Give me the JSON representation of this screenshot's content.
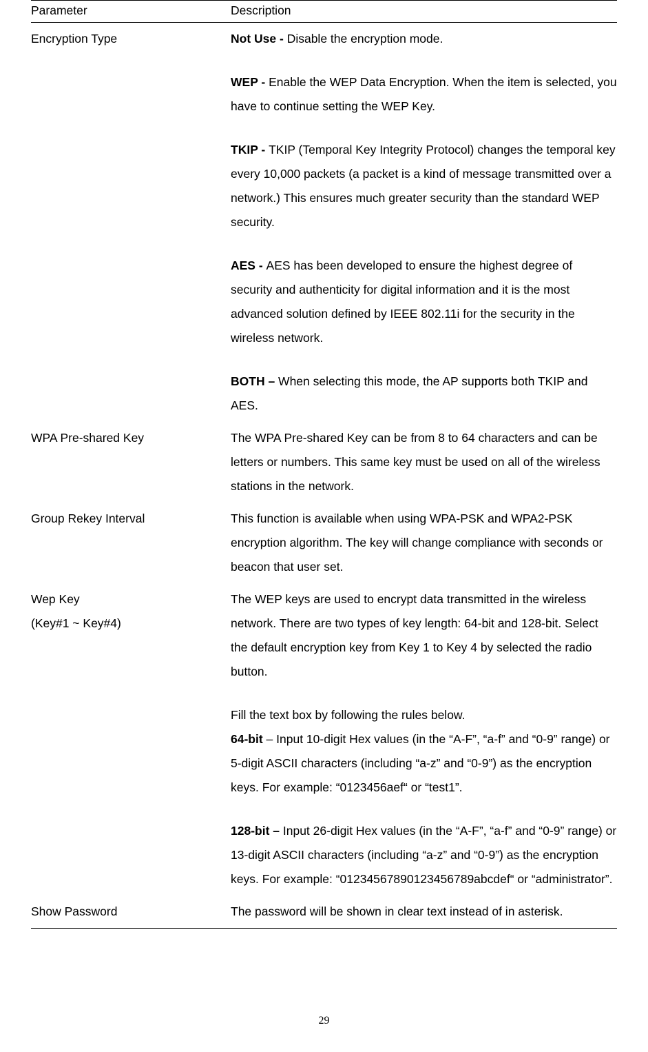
{
  "table": {
    "headers": {
      "param": "Parameter",
      "desc": "Description"
    },
    "rows": [
      {
        "param": "Encryption Type",
        "blocks": [
          {
            "bold": "Not Use - ",
            "text": "Disable the encryption mode."
          },
          {
            "bold": "WEP - ",
            "text": "Enable the WEP Data Encryption. When the item is selected, you have to continue setting the WEP Key."
          },
          {
            "bold": "TKIP - ",
            "text": "TKIP (Temporal Key Integrity Protocol) changes the temporal key every 10,000 packets (a packet is a kind of message transmitted over a network.) This ensures much greater security than the standard WEP security."
          },
          {
            "bold": "AES - ",
            "text": "AES has been developed to ensure the highest degree of security and authenticity for digital information and it is the most advanced solution defined by IEEE 802.11i for the security in the wireless network."
          },
          {
            "bold": "BOTH – ",
            "text": "When selecting this mode, the AP supports both TKIP and AES."
          }
        ]
      },
      {
        "param": "WPA Pre-shared Key",
        "blocks": [
          {
            "bold": "",
            "text": "The WPA Pre-shared Key can be from 8 to 64 characters and can be letters or numbers. This same key must be used on all of the wireless stations in the network."
          }
        ]
      },
      {
        "param": "Group Rekey Interval",
        "blocks": [
          {
            "bold": "",
            "text": "This function is available when using WPA-PSK and WPA2-PSK encryption algorithm. The key will change compliance with seconds or beacon that user set."
          }
        ]
      },
      {
        "param": "Wep Key",
        "param_line2": "(Key#1 ~ Key#4)",
        "blocks": [
          {
            "bold": "",
            "text": "The WEP keys are used to encrypt data transmitted in the wireless network. There are two types of key length: 64-bit and 128-bit. Select the default encryption key from Key 1 to Key 4 by selected the radio button."
          },
          {
            "pre": "Fill the text box by following the rules below.",
            "bold": "64-bit",
            "text": " – Input 10-digit Hex values (in the “A-F”, “a-f” and “0-9” range) or 5-digit ASCII characters (including “a-z” and “0-9”) as the encryption keys. For example: “0123456aef“ or “test1”."
          },
          {
            "bold": "128-bit – ",
            "text": "Input 26-digit Hex values (in the “A-F”, “a-f” and “0-9” range) or 13-digit ASCII characters (including “a-z” and “0-9”) as the encryption keys. For example: “01234567890123456789abcdef“ or “administrator”."
          }
        ]
      },
      {
        "param": "Show Password",
        "blocks": [
          {
            "bold": "",
            "text": "The password will be shown in clear text instead of in asterisk."
          }
        ]
      }
    ]
  },
  "page_number": "29"
}
